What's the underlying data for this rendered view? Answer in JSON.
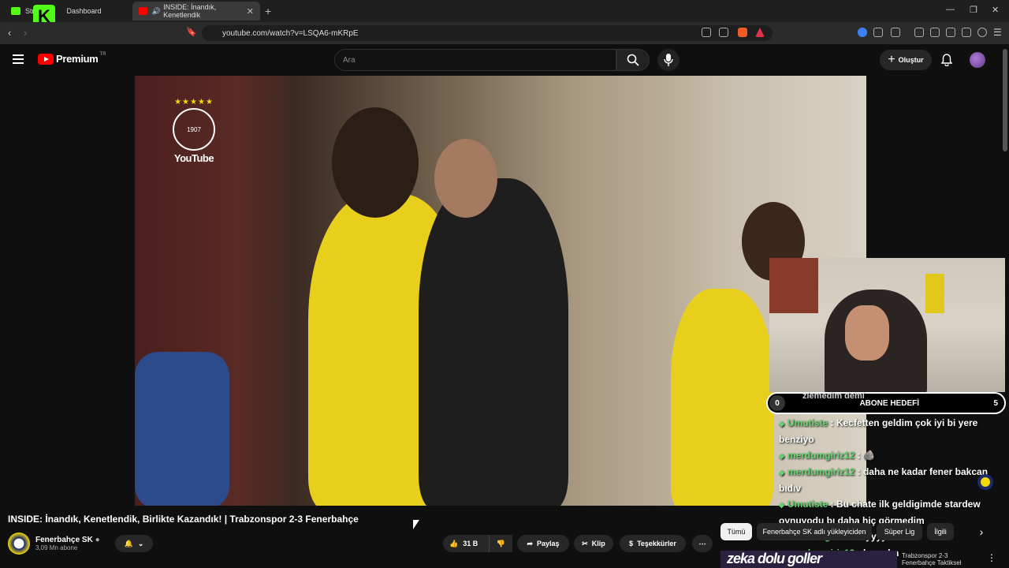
{
  "browser": {
    "tabs": [
      {
        "label": "Stre",
        "label2": "Dashboard"
      },
      {
        "label": "INSIDE: İnandık, Kenetlendik"
      }
    ],
    "url": "youtube.com/watch?v=LSQA6-mKRpE"
  },
  "youtube": {
    "brand": "Premium",
    "region": "TR",
    "search_placeholder": "Ara",
    "create_label": "Oluştur"
  },
  "video": {
    "watermark": "YouTube",
    "title": "INSIDE: İnandık, Kenetlendik, Birlikte Kazandık! | Trabzonspor 2-3 Fenerbahçe",
    "channel": "Fenerbahçe SK",
    "subscribers": "3,09 Mn abone",
    "likes": "31 B",
    "share": "Paylaş",
    "clip": "Klip",
    "thanks": "Teşekkürler"
  },
  "sidebar_chips": [
    "Tümü",
    "Fenerbahçe SK adlı yükleyiciden",
    "Süper Lig",
    "İlgili"
  ],
  "overlay": {
    "goal_label": "ABONE HEDEFİ",
    "goal_start": "0",
    "goal_end": "5",
    "chat": [
      {
        "user": "",
        "text": "zlemedim demi"
      },
      {
        "user": "Umutiste",
        "text": "Kecfetten geldim çok iyi bi yere benziyo"
      },
      {
        "user": "merdumgiriz12",
        "text": ""
      },
      {
        "user": "merdumgiriz12",
        "text": "daha ne kadar fener bakcan bıdıv"
      },
      {
        "user": "Umutiste",
        "text": "Bu chate ilk geldigimde stardew oynuyodu bı daha hiç görmedim"
      },
      {
        "user": "merdumgiriz12",
        "text": "iyyyy"
      },
      {
        "user": "merdumgiriz12",
        "text": "kapadın"
      }
    ],
    "thumb_text": "zeka dolu goller",
    "thumb_caption": "Trabzonspor 2-3 Fenerbahçe Taktiksel"
  }
}
